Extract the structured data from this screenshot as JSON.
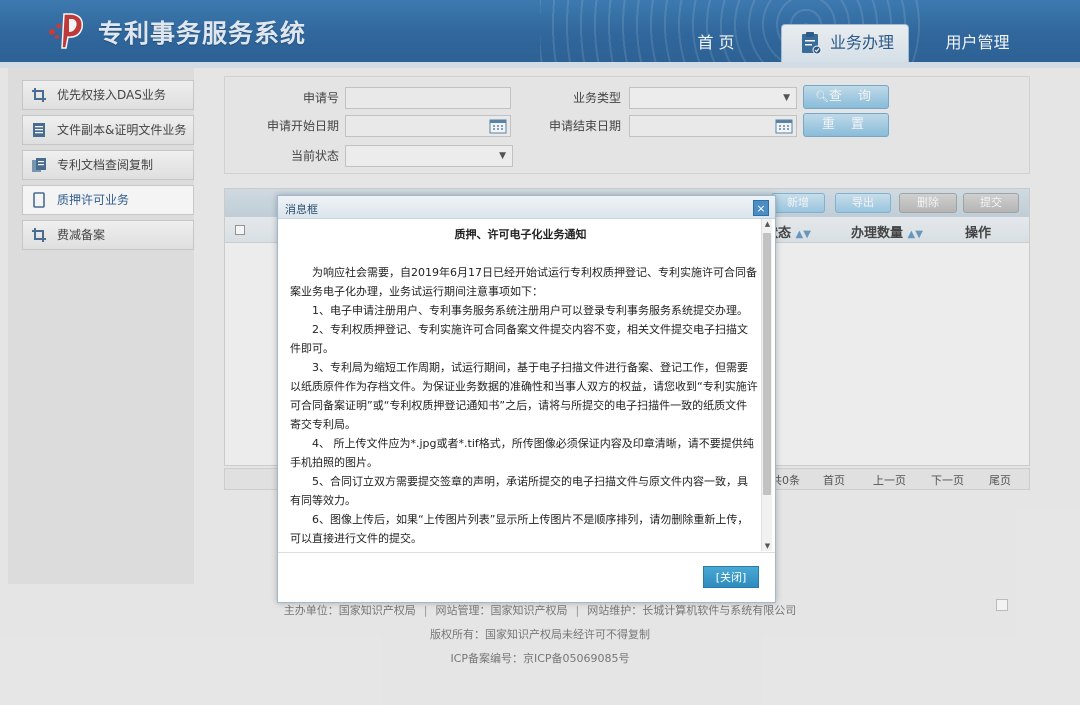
{
  "header": {
    "app_title": "专利事务服务系统",
    "nav": {
      "home": "首 页",
      "business": "业务办理",
      "users": "用户管理"
    }
  },
  "sidebar": {
    "items": [
      {
        "label": "优先权接入DAS业务"
      },
      {
        "label": "文件副本&证明文件业务"
      },
      {
        "label": "专利文档查阅复制"
      },
      {
        "label": "质押许可业务"
      },
      {
        "label": "费减备案"
      }
    ]
  },
  "query": {
    "labels": {
      "app_no": "申请号",
      "biz_type": "业务类型",
      "start_date": "申请开始日期",
      "end_date": "申请结束日期",
      "status": "当前状态"
    },
    "search_button": "查 询",
    "reset_button": "重 置"
  },
  "results": {
    "toolbar": {
      "new": "新增",
      "export": "导出",
      "delete": "删除",
      "submit": "提交"
    },
    "columns": {
      "state": "状态",
      "count": "办理数量",
      "ops": "操作"
    },
    "pager": {
      "total": "共0条",
      "first": "首页",
      "prev": "上一页",
      "next": "下一页",
      "last": "尾页"
    }
  },
  "footer": {
    "host": "主办单位：国家知识产权局",
    "manage": "网站管理：国家知识产权局",
    "maintain": "网站维护：长城计算机软件与系统有限公司",
    "copyright": "版权所有：国家知识产权局未经许可不得复制",
    "icp": "ICP备案编号：京ICP备05069085号"
  },
  "dialog": {
    "title": "消息框",
    "close_glyph": "×",
    "heading": "质押、许可电子化业务通知",
    "paragraphs": [
      "为响应社会需要，自2019年6月17日已经开始试运行专利权质押登记、专利实施许可合同备案业务电子化办理，业务试运行期间注意事项如下：",
      "1、电子申请注册用户、专利事务服务系统注册用户可以登录专利事务服务系统提交办理。",
      "2、专利权质押登记、专利实施许可合同备案文件提交内容不变，相关文件提交电子扫描文件即可。",
      "3、专利局为缩短工作周期，试运行期间，基于电子扫描文件进行备案、登记工作，但需要以纸质原件作为存档文件。为保证业务数据的准确性和当事人双方的权益，请您收到“专利实施许可合同备案证明”或“专利权质押登记通知书”之后，请将与所提交的电子扫描件一致的纸质文件寄交专利局。",
      "4、 所上传文件应为*.jpg或者*.tif格式，所传图像必须保证内容及印章清晰，请不要提供纯手机拍照的图片。",
      "5、合同订立双方需要提交签章的声明，承诺所提交的电子扫描文件与原文件内容一致，具有同等效力。",
      "6、图像上传后，如果“上传图片列表”显示所上传图片不是顺序排列，请勿删除重新上传，可以直接进行文件的提交。"
    ],
    "close_button": "[关闭]"
  }
}
